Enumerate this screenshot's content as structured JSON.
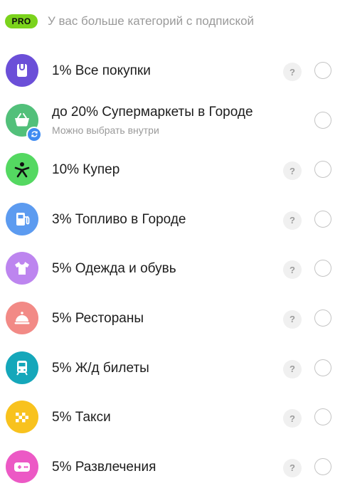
{
  "header": {
    "badge": "PRO",
    "text": "У вас больше категорий с подпиской"
  },
  "categories": [
    {
      "label": "1% Все покупки",
      "color": "#6b4fd8",
      "icon": "shopping-bag-icon",
      "help": "?"
    },
    {
      "label": "до 20% Супермаркеты в Городе",
      "sublabel": "Можно выбрать внутри",
      "color": "#52c07a",
      "icon": "basket-icon"
    },
    {
      "label": "10% Купер",
      "color": "#54d861",
      "icon": "kuper-icon",
      "help": "?"
    },
    {
      "label": "3% Топливо в Городе",
      "color": "#5c9bf0",
      "icon": "fuel-icon",
      "help": "?"
    },
    {
      "label": "5% Одежда и обувь",
      "color": "#bd85ef",
      "icon": "tshirt-icon",
      "help": "?"
    },
    {
      "label": "5% Рестораны",
      "color": "#f28a86",
      "icon": "cloche-icon",
      "help": "?"
    },
    {
      "label": "5% Ж/д билеты",
      "color": "#15a7ba",
      "icon": "train-icon",
      "help": "?"
    },
    {
      "label": "5% Такси",
      "color": "#f8c21e",
      "icon": "taxi-icon",
      "help": "?"
    },
    {
      "label": "5% Развлечения",
      "color": "#ec59c5",
      "icon": "gamepad-icon",
      "help": "?"
    }
  ]
}
